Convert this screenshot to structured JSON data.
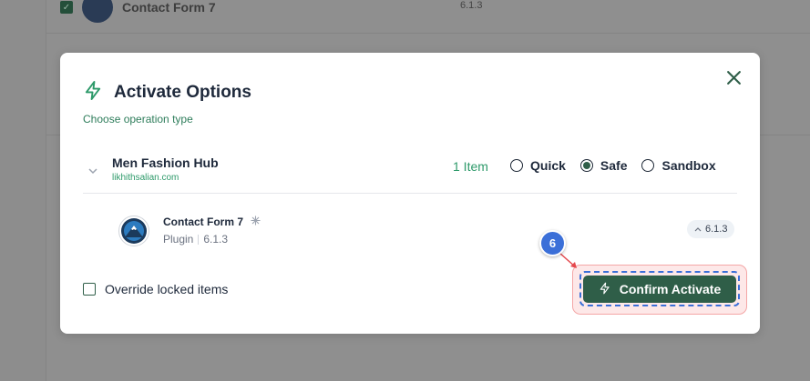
{
  "background": {
    "row1": {
      "name": "Contact Form 7",
      "version": "6.1.3"
    }
  },
  "modal": {
    "title": "Activate Options",
    "subtitle": "Choose operation type",
    "site": {
      "name": "Men Fashion Hub",
      "url": "likhithsalian.com",
      "item_count": "1 Item"
    },
    "modes": [
      {
        "label": "Quick",
        "checked": false
      },
      {
        "label": "Safe",
        "checked": true
      },
      {
        "label": "Sandbox",
        "checked": false
      }
    ],
    "plugin": {
      "name": "Contact Form 7",
      "type": "Plugin",
      "version": "6.1.3",
      "badge_version": "6.1.3"
    },
    "override_label": "Override locked items",
    "confirm_label": "Confirm Activate"
  },
  "annotation": {
    "step": "6"
  },
  "colors": {
    "accent": "#2f5e48",
    "accent_text": "#2e9a6a",
    "annotation_blue": "#3b6fd8",
    "highlight_red": "#f4a6a6"
  },
  "icons": {
    "title": "bolt-icon",
    "close": "close-icon",
    "expand": "chevron-down-icon",
    "plugin_logo": "mountain-logo-icon",
    "plugin_status": "sparkle-icon",
    "version": "chevron-up-icon",
    "confirm": "bolt-icon"
  }
}
